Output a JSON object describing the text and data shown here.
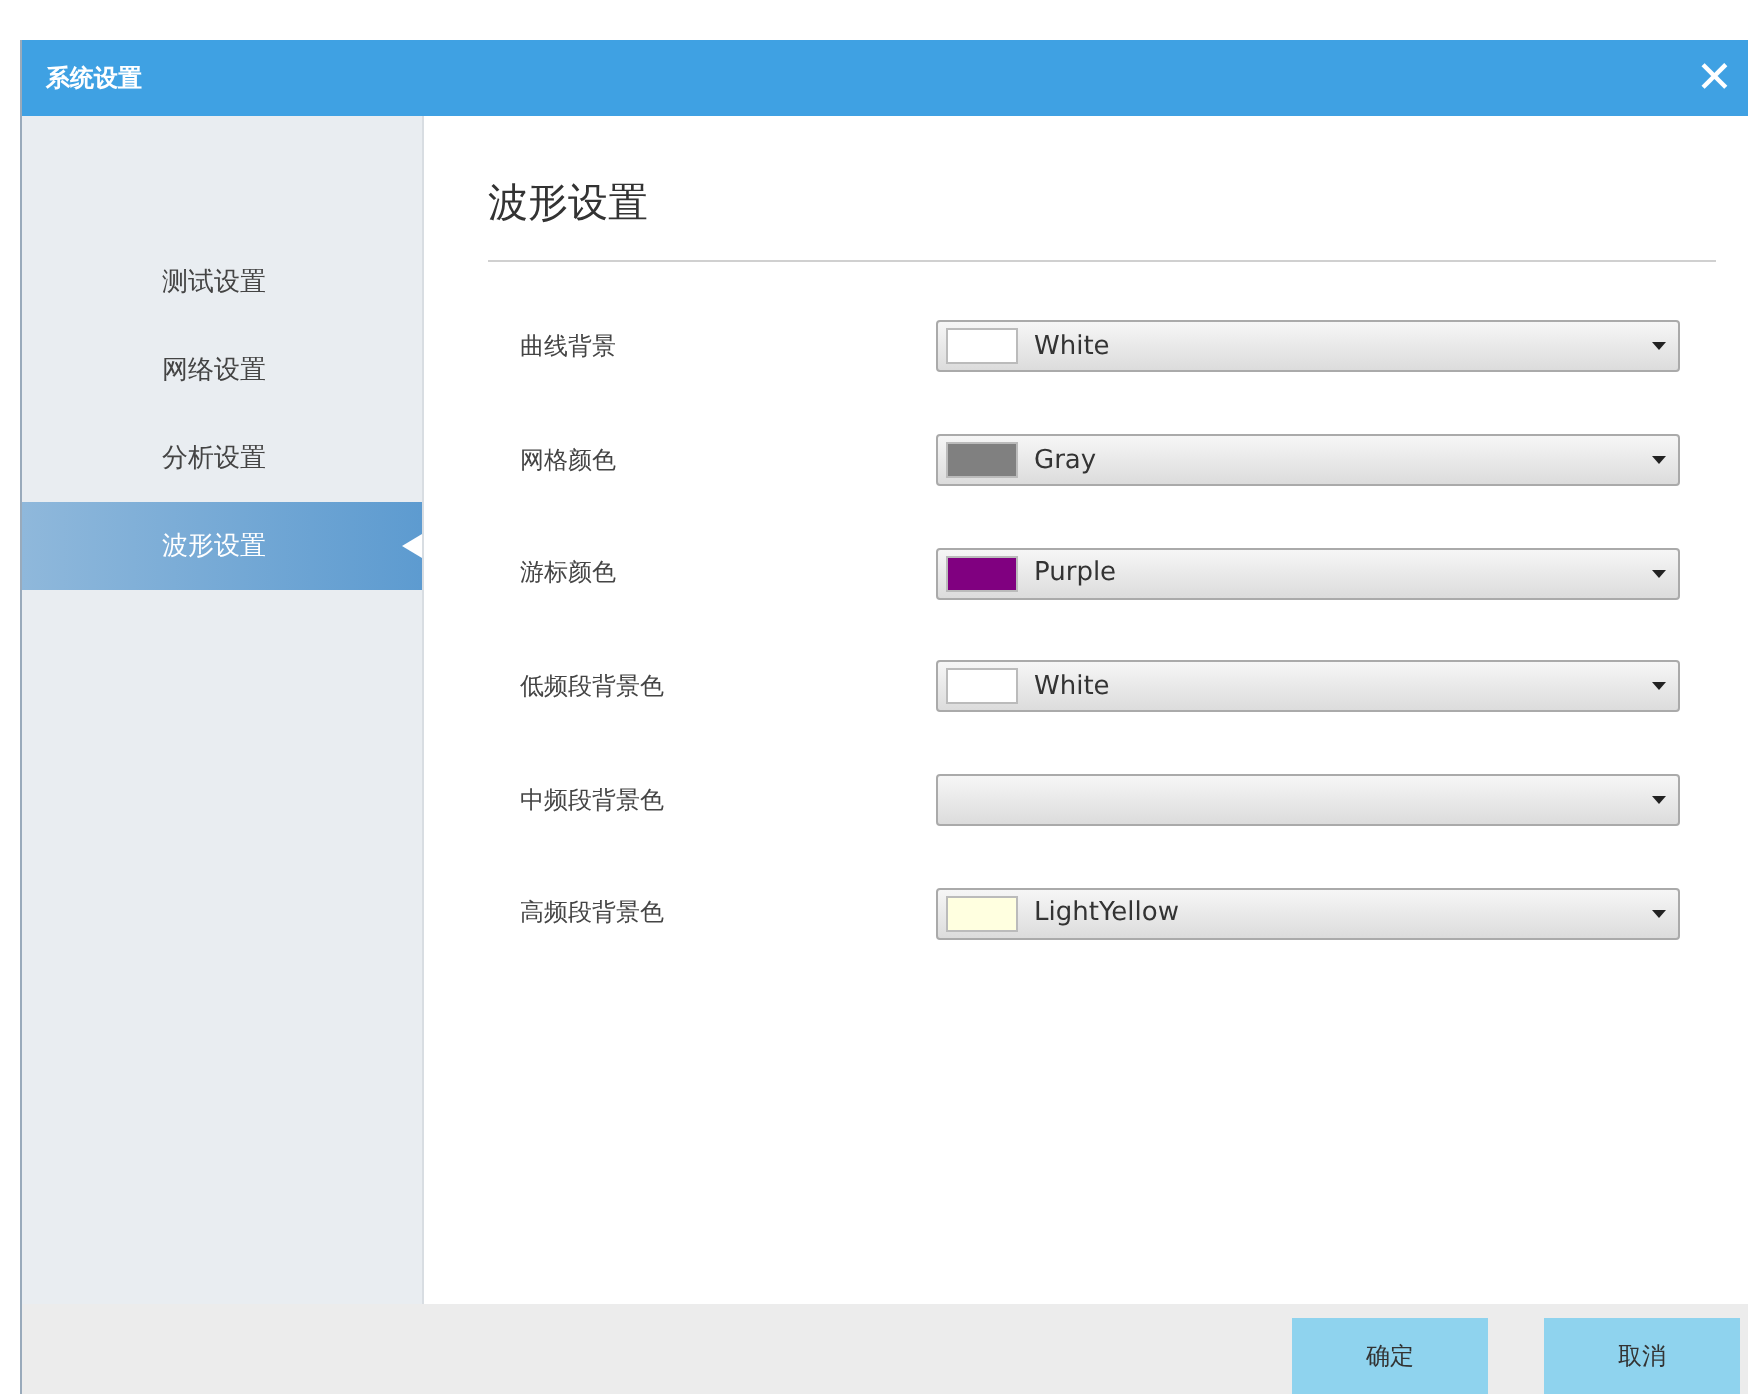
{
  "window": {
    "title": "系统设置",
    "close": "✕"
  },
  "sidebar": {
    "items": [
      {
        "label": "测试设置",
        "selected": false
      },
      {
        "label": "网络设置",
        "selected": false
      },
      {
        "label": "分析设置",
        "selected": false
      },
      {
        "label": "波形设置",
        "selected": true
      }
    ]
  },
  "content": {
    "heading": "波形设置",
    "fields": [
      {
        "label": "曲线背景",
        "value": "White",
        "color": "#ffffff"
      },
      {
        "label": "网格颜色",
        "value": "Gray",
        "color": "#808080"
      },
      {
        "label": "游标颜色",
        "value": "Purple",
        "color": "#800080"
      },
      {
        "label": "低频段背景色",
        "value": "White",
        "color": "#ffffff"
      },
      {
        "label": "中频段背景色"
      },
      {
        "label": "高频段背景色",
        "value": "LightYellow",
        "color": "#ffffe0"
      }
    ]
  },
  "buttons": [
    "确定",
    "取消"
  ]
}
